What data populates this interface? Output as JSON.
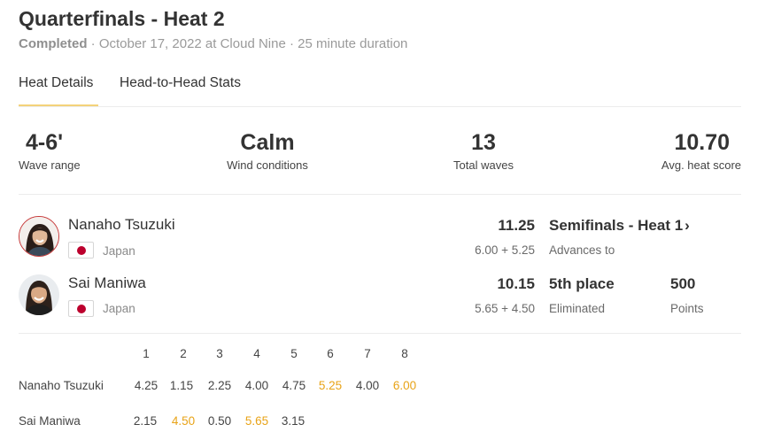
{
  "heat": {
    "title": "Quarterfinals - Heat 2",
    "status": "Completed",
    "details": " · October 17, 2022 at Cloud Nine · 25 minute duration"
  },
  "tabs": [
    {
      "label": "Heat Details",
      "active": true
    },
    {
      "label": "Head-to-Head Stats",
      "active": false
    }
  ],
  "stats": {
    "wave_range": {
      "value": "4-6'",
      "label": "Wave range"
    },
    "wind": {
      "value": "Calm",
      "label": "Wind conditions"
    },
    "total_waves": {
      "value": "13",
      "label": "Total waves"
    },
    "avg_score": {
      "value": "10.70",
      "label": "Avg. heat score"
    }
  },
  "athletes": [
    {
      "name": "Nanaho Tsuzuki",
      "country": "Japan",
      "score": "11.25",
      "breakdown": "6.00 + 5.25",
      "result": "Semifinals - Heat 1",
      "result_label": "Advances to"
    },
    {
      "name": "Sai Maniwa",
      "country": "Japan",
      "score": "10.15",
      "breakdown": "5.65 + 4.50",
      "result": "5th place",
      "result_label": "Eliminated",
      "points": "500",
      "points_label": "Points"
    }
  ],
  "wave_table": {
    "headers": [
      "1",
      "2",
      "3",
      "4",
      "5",
      "6",
      "7",
      "8"
    ],
    "rows": [
      {
        "name": "Nanaho Tsuzuki",
        "waves": [
          "4.25",
          "1.15",
          "2.25",
          "4.00",
          "4.75",
          "5.25",
          "4.00",
          "6.00"
        ]
      },
      {
        "name": "Sai Maniwa",
        "waves": [
          "2.15",
          "4.50",
          "0.50",
          "5.65",
          "3.15"
        ]
      }
    ]
  },
  "colors": {
    "accent_underline": "#f3d27a",
    "counted_wave": "#e8a317",
    "avatar_ring": "#c73a3a",
    "flag_red": "#bc002d"
  }
}
